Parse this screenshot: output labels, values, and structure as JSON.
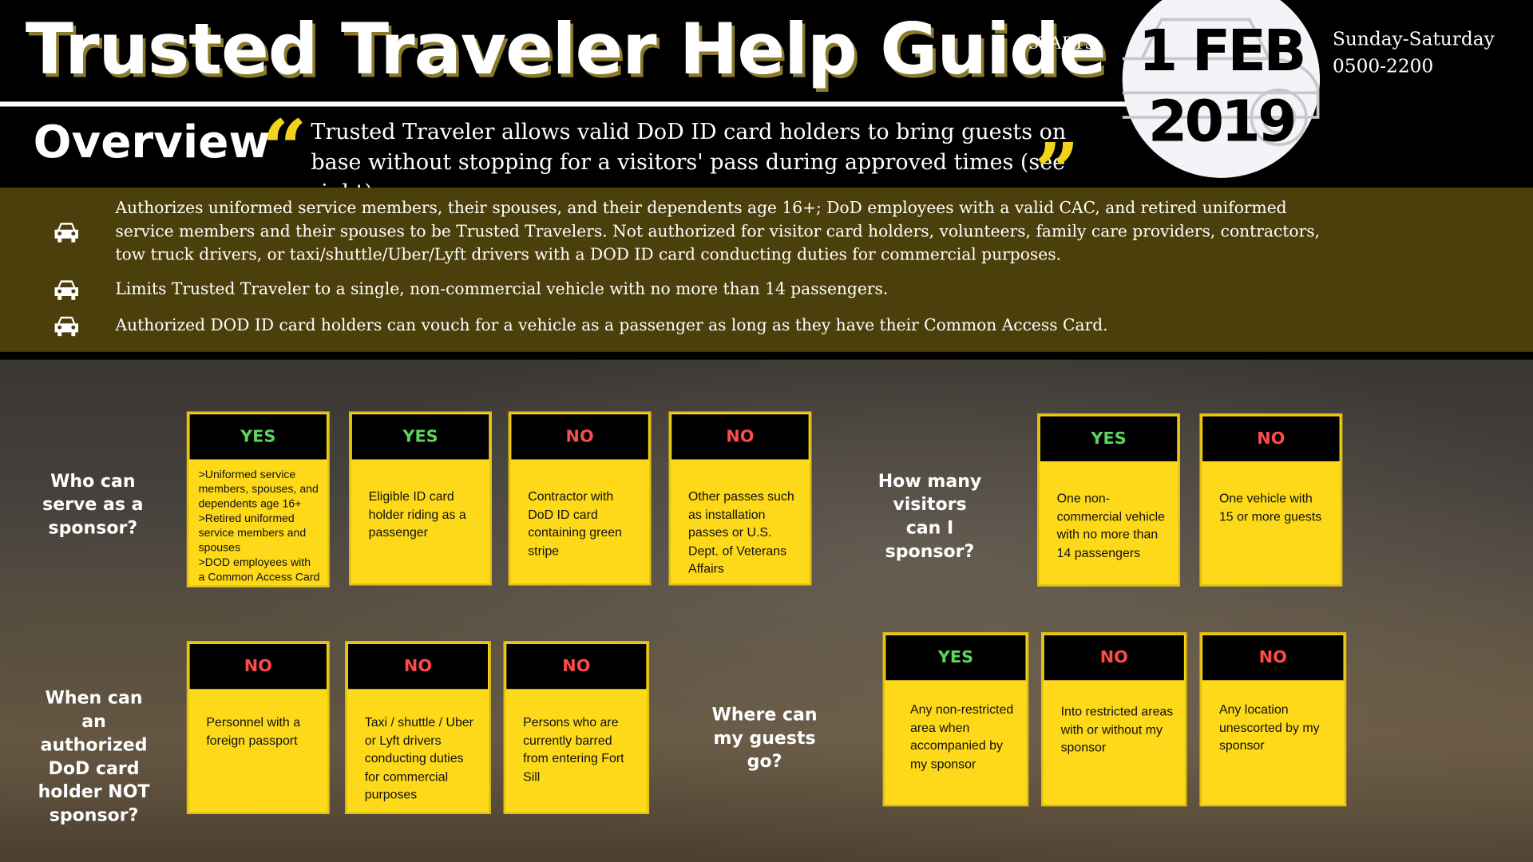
{
  "header": {
    "title": "Trusted Traveler Help Guide",
    "starts_label": "STARTS:",
    "date_line1": "1 FEB",
    "date_line2": "2019",
    "schedule_days": "Sunday-Saturday",
    "schedule_hours": "0500-2200"
  },
  "overview": {
    "heading": "Overview",
    "open_quote": "“",
    "close_quote": "”",
    "text": "Trusted Traveler allows valid DoD ID card holders to bring guests on base without stopping for a visitors' pass during approved times (see right)."
  },
  "bullets": [
    {
      "icon": "car-icon",
      "text": "Authorizes uniformed service members, their spouses, and their dependents age 16+; DoD employees with a valid CAC, and retired uniformed service members and their spouses to be Trusted Travelers. Not authorized for visitor card holders, volunteers, family care providers, contractors, tow truck drivers, or taxi/shuttle/Uber/Lyft drivers with a DOD ID card conducting duties for commercial purposes."
    },
    {
      "icon": "car-icon",
      "text": "Limits Trusted Traveler to a single, non-commercial vehicle with no more than 14 passengers."
    },
    {
      "icon": "car-icon",
      "text": "Authorized DOD ID card holders can vouch for a vehicle as a passenger as long as they have their Common Access Card."
    }
  ],
  "colors": {
    "yes": "#5fd35f",
    "no": "#ff4a4a",
    "card": "#fdd919",
    "band": "#4b400b"
  },
  "sections": {
    "sponsor": {
      "question": "Who can serve as a sponsor?",
      "cards": [
        {
          "label": "YES",
          "text": ">Uniformed service members, spouses, and dependents age 16+ >Retired uniformed service members and spouses >DOD employees with a Common Access Card"
        },
        {
          "label": "YES",
          "text": "Eligible ID card holder riding as a passenger"
        },
        {
          "label": "NO",
          "text": "Contractor with DoD ID card containing green stripe"
        },
        {
          "label": "NO",
          "text": "Other passes such as installation passes or U.S. Dept. of Veterans Affairs"
        }
      ]
    },
    "visitors": {
      "question": "How many visitors can I sponsor?",
      "cards": [
        {
          "label": "YES",
          "text": "One non-commercial vehicle with no more than 14 passengers"
        },
        {
          "label": "NO",
          "text": "One vehicle with 15 or more guests"
        }
      ]
    },
    "not_sponsor": {
      "question": "When can an authorized DoD card holder NOT sponsor?",
      "cards": [
        {
          "label": "NO",
          "text": "Personnel with a foreign passport"
        },
        {
          "label": "NO",
          "text": "Taxi / shuttle / Uber or Lyft drivers conducting duties for commercial purposes"
        },
        {
          "label": "NO",
          "text": "Persons who are currently barred from entering Fort Sill"
        }
      ]
    },
    "where": {
      "question": "Where can my guests go?",
      "cards": [
        {
          "label": "YES",
          "text": "Any non-restricted area when accompanied by my sponsor"
        },
        {
          "label": "NO",
          "text": "Into restricted areas with or without my sponsor"
        },
        {
          "label": "NO",
          "text": "Any location unescorted by my sponsor"
        }
      ]
    }
  }
}
